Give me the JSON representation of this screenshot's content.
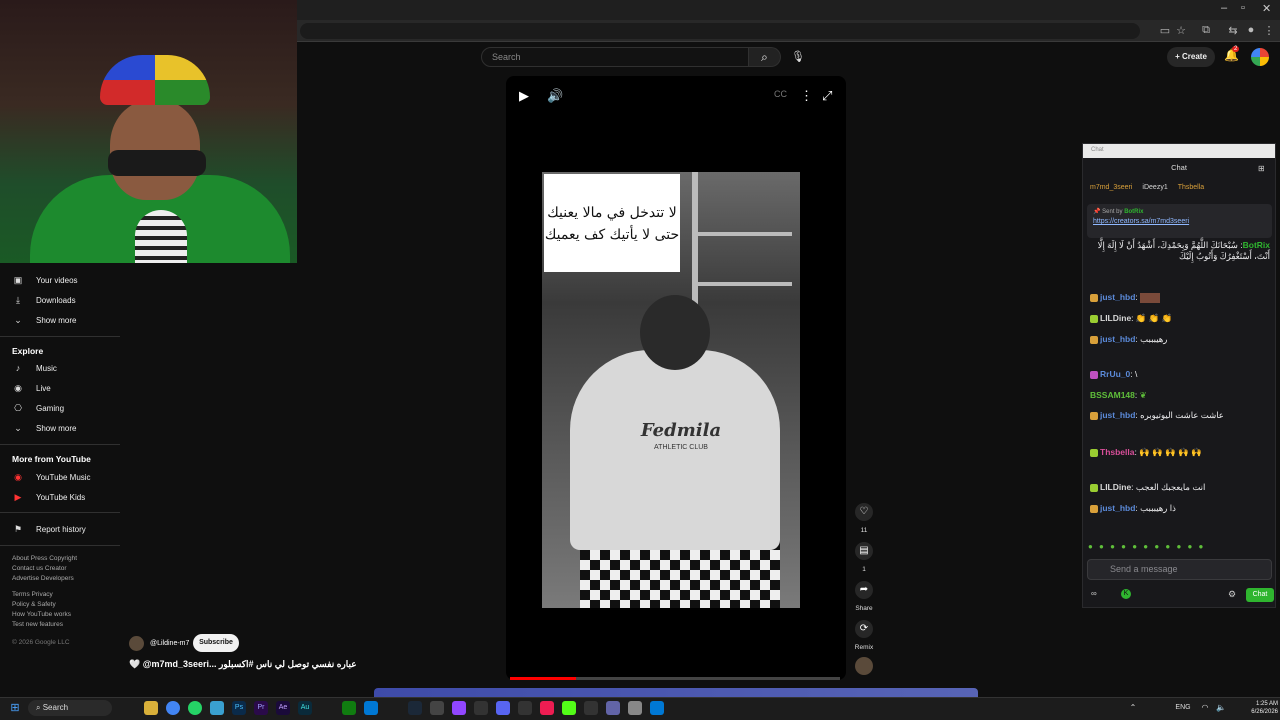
{
  "browser": {
    "window_controls": [
      "–",
      "▫",
      "✕"
    ]
  },
  "header": {
    "search_placeholder": "Search",
    "create_label": "Create",
    "notification_count": "2"
  },
  "sidebar": {
    "you_items": [
      {
        "label": "Your videos",
        "icon": "play-square-icon"
      },
      {
        "label": "Downloads",
        "icon": "download-icon"
      },
      {
        "label": "Show more",
        "icon": "chevron-down-icon"
      }
    ],
    "explore_heading": "Explore",
    "explore_items": [
      {
        "label": "Music",
        "icon": "music-note-icon"
      },
      {
        "label": "Live",
        "icon": "live-icon"
      },
      {
        "label": "Gaming",
        "icon": "gamepad-icon"
      },
      {
        "label": "Show more",
        "icon": "chevron-down-icon"
      }
    ],
    "more_heading": "More from YouTube",
    "more_items": [
      {
        "label": "YouTube Music",
        "icon": "youtube-music-icon"
      },
      {
        "label": "YouTube Kids",
        "icon": "youtube-kids-icon"
      }
    ],
    "report_history": "Report history",
    "footer_1": "About  Press  Copyright\nContact us  Creator\nAdvertise  Developers",
    "footer_2": "Terms  Privacy\nPolicy & Safety\nHow YouTube works\nTest new features",
    "copyright": "© 2026 Google LLC"
  },
  "video": {
    "caption_line1": "لا تتدخل في مالا يعنيك",
    "caption_line2": "حتى لا يأتيك كف يعميك",
    "hoodie_logo": "Fedmila",
    "hoodie_sub": "ATHLETIC CLUB",
    "progress": 0.2
  },
  "actions": {
    "like_count": "11",
    "comment_count": "1",
    "share_label": "Share",
    "remix_label": "Remix"
  },
  "channel": {
    "name": "@Lildine-m7",
    "subscribe_label": "Subscribe",
    "title": "🤍 @m7md_3seeri...  عباره نفسي توصل لي ناس  #اكسبلور"
  },
  "chat": {
    "topbar": "Chat",
    "title": "Chat",
    "tabs": [
      "m7md_3seeri",
      "iDeezy1",
      "Thsbella"
    ],
    "pinned_label": "Sent by",
    "pinned_user": "BotRix",
    "pinned_link": "https://creators.sa/m7md3seeri",
    "messages": [
      {
        "user": "BotRix",
        "color": "#2fb52f",
        "text": "سُبْحَانَكَ اللَّهُمَّ وَبِحَمْدِكَ، أَشْهَدُ أَنْ لَا إِلَهَ إِلَّا أَنْتَ، أَسْتَغْفِرُكَ وَأَتُوبُ إِلَيْكَ"
      },
      {
        "user": "just_hbd",
        "color": "#5b8ad9",
        "text": ""
      },
      {
        "user": "LILDine",
        "color": "#d7d7d7",
        "text": "👏 👏 👏"
      },
      {
        "user": "just_hbd",
        "color": "#5b8ad9",
        "text": "رهيبببب"
      },
      {
        "user": "RrUu_0",
        "color": "#5b8ad9",
        "text": "\\"
      },
      {
        "user": "BSSAM148",
        "color": "#5fbf3a",
        "text": ""
      },
      {
        "user": "just_hbd",
        "color": "#5b8ad9",
        "text": "عاشت عاشت اليوتيوبره"
      },
      {
        "user": "Thsbella",
        "color": "#d94f9a",
        "text": "🙌 🙌 🙌 🙌 🙌"
      },
      {
        "user": "LILDine",
        "color": "#d7d7d7",
        "text": "انت مايعجبك العجب"
      },
      {
        "user": "just_hbd",
        "color": "#5b8ad9",
        "text": "ذا رهيبببب"
      }
    ],
    "input_placeholder": "Send a message",
    "send_label": "Chat"
  },
  "taskbar": {
    "search_label": "Search",
    "lang": "ENG",
    "time": "1:25 AM",
    "date": "6/26/2026"
  }
}
